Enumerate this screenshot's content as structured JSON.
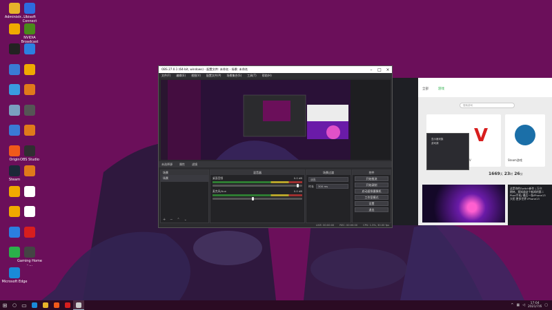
{
  "colors": {
    "wallpaper": "#6b0f5a",
    "taskbar": "#2b0b23",
    "obs_bg": "#2b2b2e",
    "launcher_bg": "#ececec",
    "accent_green": "#2bb04a"
  },
  "desktop_icons": [
    {
      "label": "Administr...",
      "icon": "user-folder-icon",
      "color": "#e6b32a"
    },
    {
      "label": "Ubisoft Connect",
      "icon": "ubisoft-icon",
      "color": "#2d6be0"
    },
    {
      "label": "",
      "icon": "app-icon",
      "color": "#f0a900"
    },
    {
      "label": "NVIDIA Broadcast",
      "icon": "nvidia-icon",
      "color": "#4a8a1a"
    },
    {
      "label": "",
      "icon": "capcut-icon",
      "color": "#222222"
    },
    {
      "label": "",
      "icon": "app-k-icon",
      "color": "#2b7fe0"
    },
    {
      "label": "",
      "icon": "computer-icon",
      "color": "#3a7bd5"
    },
    {
      "label": "",
      "icon": "app-icon",
      "color": "#f0a900"
    },
    {
      "label": "",
      "icon": "network-icon",
      "color": "#3a9be0"
    },
    {
      "label": "",
      "icon": "app-icon",
      "color": "#e07a1a"
    },
    {
      "label": "",
      "icon": "recycle-bin-icon",
      "color": "#7aa0c0"
    },
    {
      "label": "",
      "icon": "app-icon",
      "color": "#555555"
    },
    {
      "label": "",
      "icon": "app-icon",
      "color": "#3a7bd5"
    },
    {
      "label": "",
      "icon": "app-icon",
      "color": "#e07a1a"
    },
    {
      "label": "Origin",
      "icon": "origin-icon",
      "color": "#f05a1a"
    },
    {
      "label": "OBS Studio",
      "icon": "obs-icon",
      "color": "#302e31"
    },
    {
      "label": "Steam",
      "icon": "steam-icon",
      "color": "#1b2838"
    },
    {
      "label": "",
      "icon": "app-icon",
      "color": "#e07a1a"
    },
    {
      "label": "",
      "icon": "app-icon",
      "color": "#f0a900"
    },
    {
      "label": "",
      "icon": "document-icon",
      "color": "#ffffff"
    },
    {
      "label": "",
      "icon": "app-icon",
      "color": "#f0a900"
    },
    {
      "label": "",
      "icon": "document-icon",
      "color": "#ffffff"
    },
    {
      "label": "",
      "icon": "app-icon",
      "color": "#2b7fe0"
    },
    {
      "label": "",
      "icon": "netease-icon",
      "color": "#d81e1e"
    },
    {
      "label": "",
      "icon": "wechat-icon",
      "color": "#2bb04a"
    },
    {
      "label": "Gaming Home - ...",
      "icon": "gaming-icon",
      "color": "#444444"
    },
    {
      "label": "Microsoft Edge",
      "icon": "edge-icon",
      "color": "#1a8ad8"
    }
  ],
  "obs": {
    "title": "OBS 27.0.1 (64-bit, windows) - 配置文件: 未命名 - 场景: 未命名",
    "menu": [
      "文件(F)",
      "编辑(E)",
      "视图(V)",
      "配置文件(P)",
      "场景集合(S)",
      "工具(T)",
      "帮助(H)"
    ],
    "source_bar": {
      "title": "未选择源",
      "properties": "属性",
      "filters": "滤镜"
    },
    "scenes": {
      "title": "场景",
      "items": [
        "场景"
      ]
    },
    "mixer": {
      "title": "混音器",
      "tracks": [
        {
          "name": "桌面音频",
          "db": "0.0 dB",
          "fader": 0.95
        },
        {
          "name": "麦克风/Aux",
          "db": "0.0 dB",
          "fader": 0.45
        }
      ]
    },
    "transitions": {
      "title": "场景过渡",
      "type": "淡出",
      "duration_label": "时长",
      "duration": "300 ms"
    },
    "controls": {
      "title": "控件",
      "buttons": [
        "开始推流",
        "开始录制",
        "启动虚拟摄像机",
        "工作室模式",
        "设置",
        "退出"
      ]
    },
    "status": [
      "LIVE: 00:00:00",
      "REC: 00:00:00",
      "CPU: 1.3%, 30.00 fps"
    ]
  },
  "launcher": {
    "tabs": [
      "全部",
      "游戏"
    ],
    "search_placeholder": "搜索游戏",
    "games": [
      {
        "label": "",
        "icon": "game-icon"
      },
      {
        "label": "街霸V",
        "icon": "street-fighter-icon"
      },
      {
        "label": "Steam游戏",
        "icon": "steam-icon"
      }
    ],
    "countdown": {
      "days": "1669",
      "days_unit": "天",
      "hours": "23",
      "hours_unit": "时",
      "minutes": "26",
      "minutes_unit": "分"
    },
    "news": [
      "这是你的Switch新作 | 万众",
      "期待，我知道这个新闻的第二",
      "Pixel手机/ 最后一条iPhone13",
      "大招 更多世界 iPhone13"
    ]
  },
  "mini_obs": {
    "rows": [
      "显示器采集",
      "游戏源"
    ]
  },
  "taskbar": {
    "apps": [
      {
        "icon": "edge-icon",
        "color": "#1a8ad8",
        "active": false
      },
      {
        "icon": "file-explorer-icon",
        "color": "#e6b32a",
        "active": false
      },
      {
        "icon": "app-icon",
        "color": "#f05a1a",
        "active": false
      },
      {
        "icon": "app-icon",
        "color": "#d81e1e",
        "active": false
      },
      {
        "icon": "obs-icon",
        "color": "#cccccc",
        "active": true
      }
    ],
    "time": "17:04",
    "date": "2021/7/6"
  }
}
